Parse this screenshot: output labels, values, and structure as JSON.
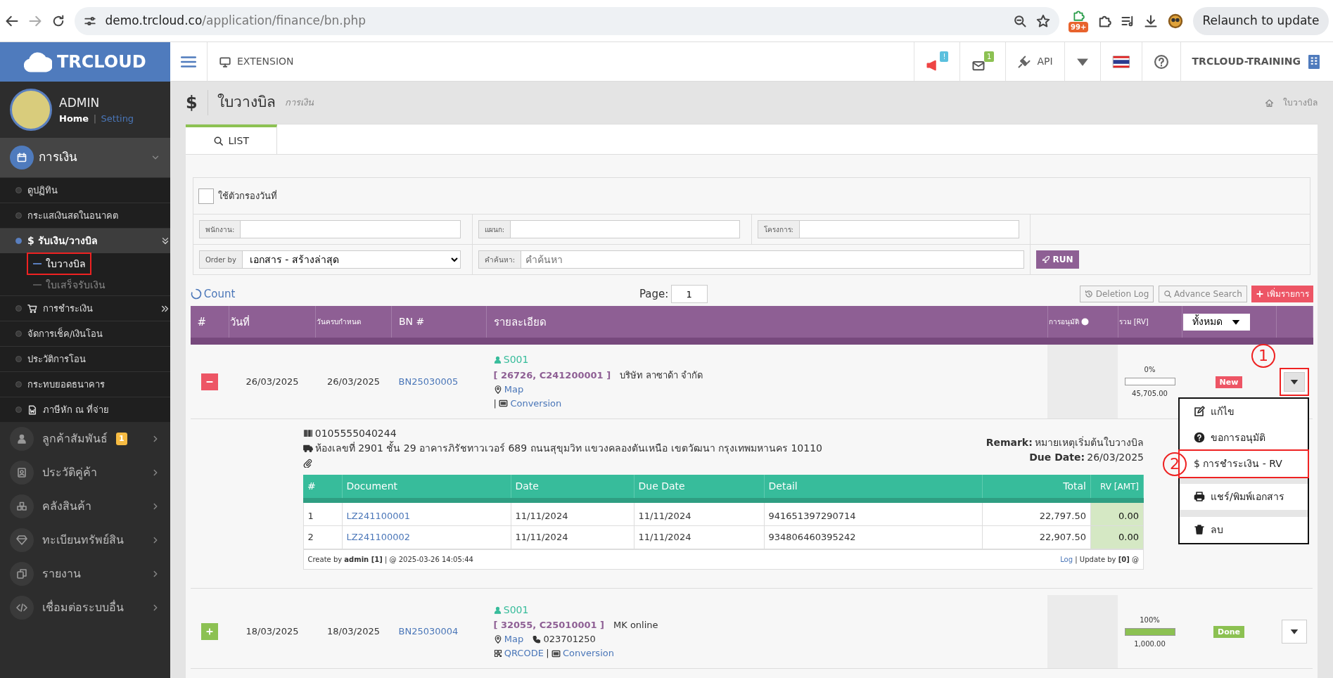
{
  "browser": {
    "url_host": "demo.trcloud.co",
    "url_path": "/application/finance/bn.php",
    "extension_badge": "99+",
    "relaunch_button": "Relaunch to update"
  },
  "header": {
    "logo": "TRCLOUD",
    "extension": "EXTENSION",
    "alerts": [
      {
        "kind": "megaphone",
        "count": "!"
      },
      {
        "kind": "mail",
        "count": "1"
      }
    ],
    "api": "API",
    "company": "TRCLOUD-TRAINING"
  },
  "user": {
    "name": "ADMIN",
    "home_link": "Home",
    "separator": "|",
    "setting_link": "Setting"
  },
  "sidebar": {
    "items": [
      {
        "label": "การเงิน",
        "selected": true,
        "expanded": true,
        "children": [
          {
            "kind": "link",
            "label": "ดูปฏิทิน",
            "selected": false
          },
          {
            "kind": "link",
            "label": "กระแสเงินสดในอนาคต",
            "selected": false
          },
          {
            "kind": "group",
            "label": "$ รับเงิน/วางบิล",
            "selected": true,
            "expanded": true,
            "children": [
              {
                "label": "ใบวางบิล",
                "selected": true,
                "highlighted": true
              },
              {
                "label": "ใบเสร็จรับเงิน",
                "selected": false,
                "highlighted": false
              }
            ]
          },
          {
            "kind": "group",
            "label": "การชำระเงิน",
            "selected": false,
            "expanded": false
          },
          {
            "kind": "link",
            "label": "จัดการเช็ค/เงินโอน",
            "selected": false
          },
          {
            "kind": "link",
            "label": "ประวัติการโอน",
            "selected": false
          },
          {
            "kind": "link",
            "label": "กระทบยอดธนาคาร",
            "selected": false
          },
          {
            "kind": "link",
            "label": "ภาษีหัก ณ ที่จ่าย",
            "selected": false
          }
        ]
      },
      {
        "label": "ลูกค้าสัมพันธ์",
        "badge": "1",
        "selected": false,
        "expanded": false
      },
      {
        "label": "ประวัติคู่ค้า",
        "selected": false,
        "expanded": false
      },
      {
        "label": "คลังสินค้า",
        "selected": false,
        "expanded": false
      },
      {
        "label": "ทะเบียนทรัพย์สิน",
        "selected": false,
        "expanded": false
      },
      {
        "label": "รายงาน",
        "selected": false,
        "expanded": false
      },
      {
        "label": "เชื่อมต่อระบบอื่น",
        "selected": false,
        "expanded": false
      }
    ]
  },
  "page": {
    "symbol": "$",
    "title": "ใบวางบิล",
    "subtitle": "การเงิน",
    "breadcrumb": "ใบวางบิล"
  },
  "tabs": [
    {
      "label": "LIST",
      "selected": true
    }
  ],
  "filters": {
    "date_filter": {
      "label": "ใช้ตัวกรองวันที่",
      "checked": false
    },
    "fields": [
      {
        "label": "พนักงาน:"
      },
      {
        "label": "แผนก:"
      },
      {
        "label": "โครงการ:"
      }
    ],
    "order_by": {
      "label": "Order by",
      "value": "เอกสาร - สร้างล่าสุด"
    },
    "search": {
      "label": "คำค้นหา:",
      "placeholder": "คำค้นหา"
    },
    "run_button": "RUN"
  },
  "toolbar": {
    "count": "Count",
    "page_label": "Page:",
    "page": "1",
    "buttons": [
      "Deletion Log",
      "Advance Search",
      "เพิ่มรายการ"
    ]
  },
  "table": {
    "columns": [
      "#",
      "วันที่",
      "วันครบกำหนด",
      "BN #",
      "รายละเอียด",
      "การอนุมัติ",
      "รวม [RV]"
    ],
    "status_filter": "ทั้งหมด",
    "rows": [
      {
        "expanded": true,
        "date": "26/03/2025",
        "due_date": "26/03/2025",
        "bn": "BN25030005",
        "staff": "S001",
        "codes": "[ 26726, C241200001 ]",
        "customer": "บริษัท ลาซาด้า จำกัด",
        "map": "Map",
        "separator": "|",
        "conversion": "Conversion",
        "percent": "0%",
        "level": 0,
        "total": "45,705.00",
        "status": {
          "kind": "new",
          "label": "New"
        },
        "toggle_highlighted": true,
        "toggle_marker": "1",
        "menu_open": true,
        "detail": {
          "tax_id": "0105555040244",
          "address": "ห้องเลขที่ 2901 ชั้น 29 อาคารภิรัชทาวเวอร์ 689 ถนนสุขุมวิท แขวงคลองตันเหนือ เขตวัฒนา กรุงเทพมหานคร 10110",
          "remark_label": "Remark:",
          "remark": "หมายเหตุเริ่มต้นใบวางบิล",
          "due_label": "Due Date:",
          "due": "26/03/2025",
          "columns": [
            "#",
            "Document",
            "Date",
            "Due Date",
            "Detail",
            "Total",
            "RV [AMT]"
          ],
          "rows": [
            [
              "1",
              "LZ241100001",
              "11/11/2024",
              "11/11/2024",
              "941651397290714",
              "22,797.50",
              "0.00"
            ],
            [
              "2",
              "LZ241100002",
              "11/11/2024",
              "11/11/2024",
              "934806460395242",
              "22,907.50",
              "0.00"
            ]
          ],
          "created": "Create by **admin [1]** | @ 2025-03-26 14:05:44",
          "log_link": "Log",
          "updated": "| Update by **[0]** @"
        }
      },
      {
        "expanded": false,
        "date": "18/03/2025",
        "due_date": "18/03/2025",
        "bn": "BN25030004",
        "staff": "S001",
        "codes": "[ 32055, C25010001 ]",
        "customer": "MK online",
        "map": "Map",
        "phone": "023701250",
        "qrcode": "QRCODE",
        "separator": "|",
        "conversion": "Conversion",
        "percent": "100%",
        "level": 1,
        "total": "1,000.00",
        "status": {
          "kind": "done",
          "label": "Done"
        },
        "toggle_highlighted": false,
        "menu_open": false
      }
    ]
  },
  "row_menu": {
    "items": [
      {
        "kind": "edit",
        "label": "แก้ไข",
        "highlighted": false
      },
      {
        "kind": "approve",
        "label": "ขอการอนุมัติ",
        "highlighted": false
      },
      {
        "kind": "pay",
        "label": "$ การชำระเงิน - RV",
        "highlighted": true,
        "marker": "2"
      },
      {
        "kind": "print",
        "label": "แชร์/พิมพ์เอกสาร",
        "highlighted": false,
        "divider_before": true
      },
      {
        "kind": "delete",
        "label": "ลบ",
        "highlighted": false,
        "divider_before": true
      }
    ]
  }
}
